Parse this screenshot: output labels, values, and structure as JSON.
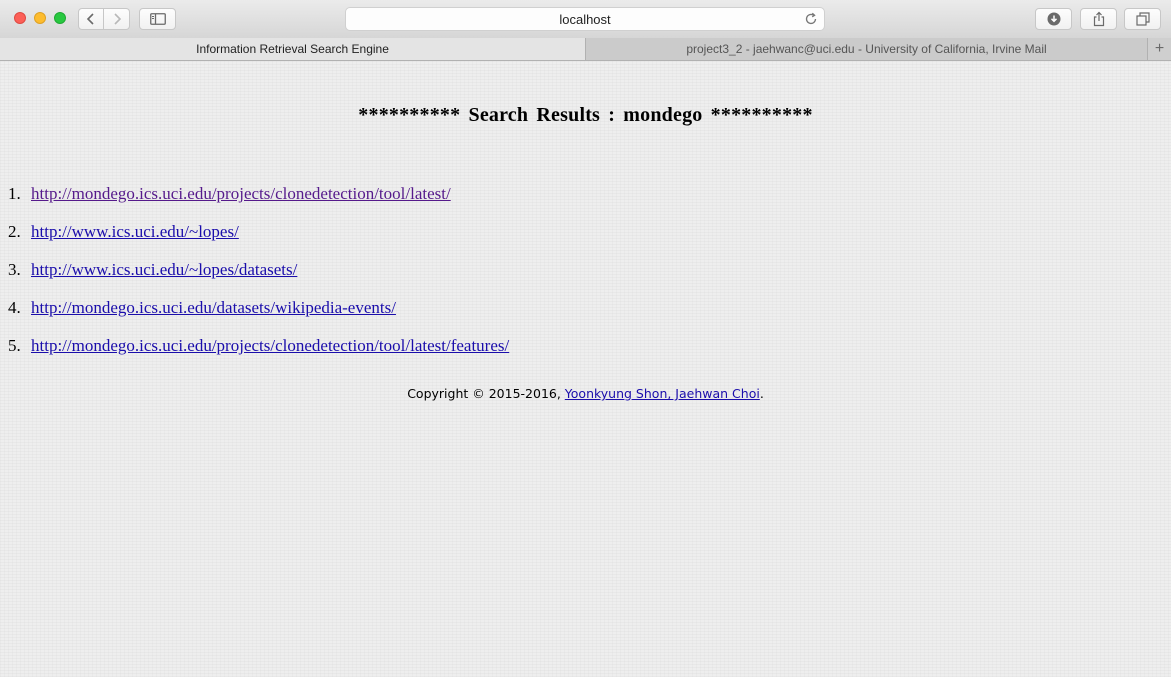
{
  "browser": {
    "url": "localhost",
    "tabs": [
      {
        "label": "Information Retrieval Search Engine",
        "active": true
      },
      {
        "label": "project3_2 - jaehwanc@uci.edu - University of California, Irvine Mail",
        "active": false
      }
    ],
    "add_tab_label": "+",
    "icons": {
      "close": "close-icon",
      "minimize": "minimize-icon",
      "maximize": "maximize-icon",
      "back": "chevron-left-icon",
      "forward": "chevron-right-icon",
      "sidebar": "sidebar-icon",
      "reload": "reload-icon",
      "download": "download-icon",
      "share": "share-icon",
      "tabs": "tabs-overview-icon"
    }
  },
  "page": {
    "heading": "********** Search Results : mondego **********",
    "results": [
      {
        "number": "1.",
        "url": "http://mondego.ics.uci.edu/projects/clonedetection/tool/latest/",
        "visited": true
      },
      {
        "number": "2.",
        "url": "http://www.ics.uci.edu/~lopes/",
        "visited": false
      },
      {
        "number": "3.",
        "url": "http://www.ics.uci.edu/~lopes/datasets/",
        "visited": false
      },
      {
        "number": "4.",
        "url": "http://mondego.ics.uci.edu/datasets/wikipedia-events/",
        "visited": false
      },
      {
        "number": "5.",
        "url": "http://mondego.ics.uci.edu/projects/clonedetection/tool/latest/features/",
        "visited": false
      }
    ],
    "footer": {
      "prefix": "Copyright © 2015-2016, ",
      "link": "Yoonkyung Shon, Jaehwan Choi",
      "suffix": "."
    }
  },
  "colors": {
    "link": "#1a0dab",
    "visited_link": "#551a8b",
    "page_background": "#eeeeee"
  }
}
